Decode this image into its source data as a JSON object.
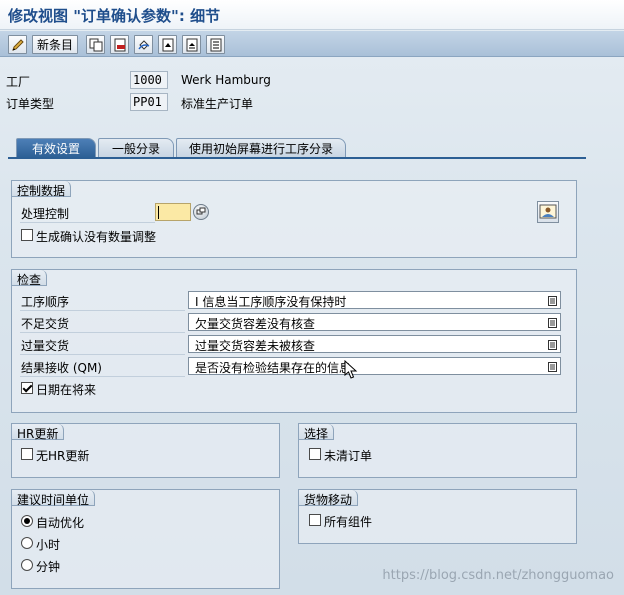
{
  "window": {
    "title": "修改视图 \"订单确认参数\": 细节"
  },
  "toolbar": {
    "new_entries_label": "新条目",
    "icons": [
      "display-change-icon",
      "copy-icon",
      "delete-icon",
      "undo-icon",
      "first-entry-icon",
      "previous-entry-icon",
      "next-entry-icon",
      "last-entry-icon"
    ]
  },
  "header": {
    "plant_label": "工厂",
    "plant_value": "1000",
    "plant_desc": "Werk Hamburg",
    "order_type_label": "订单类型",
    "order_type_value": "PP01",
    "order_type_desc": "标准生产订单"
  },
  "tabs": [
    {
      "label": "有效设置",
      "active": true
    },
    {
      "label": "一般分录",
      "active": false
    },
    {
      "label": "使用初始屏幕进行工序分录",
      "active": false
    }
  ],
  "control_data": {
    "title": "控制数据",
    "process_control_label": "处理控制",
    "process_control_value": "",
    "gen_confirm_label": "生成确认没有数量调整",
    "gen_confirm_checked": false
  },
  "checks": {
    "title": "检查",
    "rows": [
      {
        "label": "工序顺序",
        "value": "I 信息当工序顺序没有保持时"
      },
      {
        "label": "不足交货",
        "value": "欠量交货容差没有核查"
      },
      {
        "label": "过量交货",
        "value": "过量交货容差未被核查"
      },
      {
        "label": "结果接收 (QM)",
        "value": "是否没有检验结果存在的信息"
      }
    ],
    "date_future_label": "日期在将来",
    "date_future_checked": true
  },
  "hr_update": {
    "title": "HR更新",
    "no_hr_label": "无HR更新",
    "no_hr_checked": false
  },
  "selection": {
    "title": "选择",
    "uncleared_label": "未清订单",
    "uncleared_checked": false
  },
  "time_unit": {
    "title": "建议时间单位",
    "options": [
      "自动优化",
      "小时",
      "分钟"
    ],
    "selected": "自动优化"
  },
  "goods_movement": {
    "title": "货物移动",
    "all_components_label": "所有组件",
    "all_components_checked": false
  },
  "watermark": "https://blog.csdn.net/zhongguomao",
  "colors": {
    "accent": "#2c5f94",
    "title": "#1f4e8c",
    "input_required": "#fbe9a5"
  }
}
